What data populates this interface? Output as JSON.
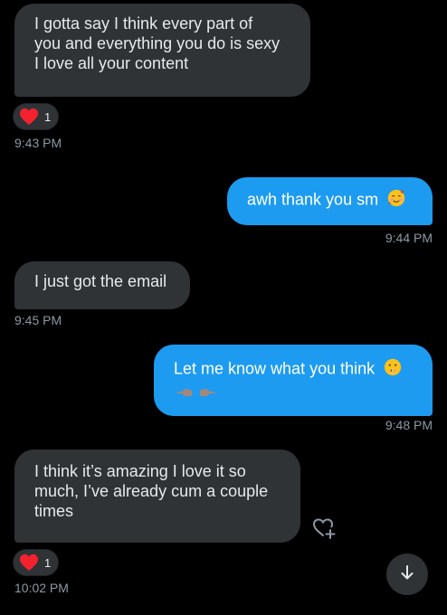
{
  "colors": {
    "background": "#000000",
    "received_bubble": "#2f3336",
    "sent_bubble": "#1d9bf0",
    "timestamp": "#8b98a5",
    "heart": "#f4212e"
  },
  "messages": [
    {
      "direction": "received",
      "lines": [
        "I gotta say I think every part of",
        "you and everything you do is sexy",
        "I love all your content"
      ],
      "reaction": {
        "icon": "red-heart-emoji",
        "count": "1"
      },
      "time": "9:43 PM"
    },
    {
      "direction": "sent",
      "text": "awh thank you sm",
      "emoji": "smiling-face-with-hearts-emoji",
      "time": "9:44 PM"
    },
    {
      "direction": "received",
      "lines": [
        "I just got the email"
      ],
      "time": "9:45 PM"
    },
    {
      "direction": "sent",
      "text": "Let me know what you think",
      "emoji": "shushing-face-emoji",
      "emoji_line2": [
        "backhand-index-pointing-left-emoji",
        "backhand-index-pointing-right-emoji"
      ],
      "time": "9:48 PM"
    },
    {
      "direction": "received",
      "lines": [
        "I think it’s amazing I love it so",
        "much, I’ve already cum a couple",
        "times"
      ],
      "reaction": {
        "icon": "red-heart-emoji",
        "count": "1"
      },
      "time": "10:02 PM"
    }
  ],
  "icons": {
    "add_reaction": "heart-plus-icon",
    "scroll_down": "arrow-down-icon"
  }
}
